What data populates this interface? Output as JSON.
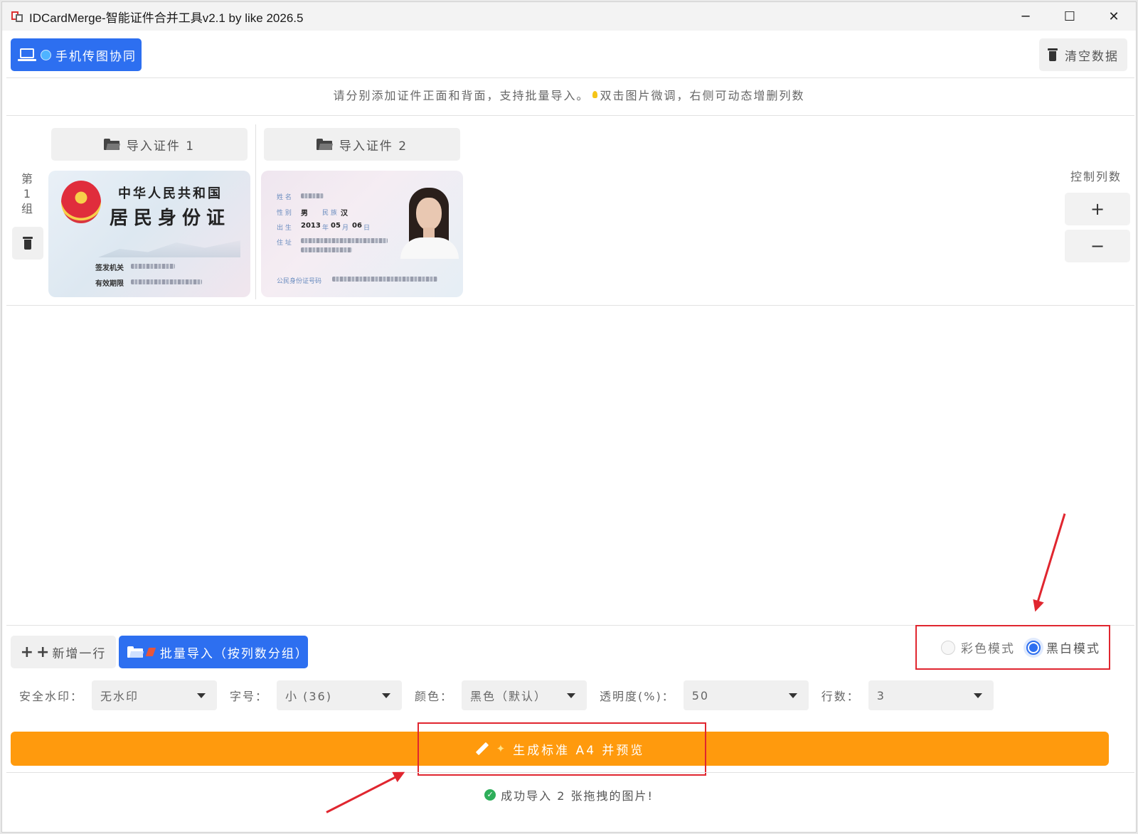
{
  "window": {
    "title": "IDCardMerge-智能证件合并工具v2.1 by like 2026.5",
    "minimize": "─",
    "maximize": "☐",
    "close": "✕"
  },
  "toolbar": {
    "mobile_label": "手机传图协同",
    "clear_label": "清空数据"
  },
  "hint": {
    "part1": "请分别添加证件正面和背面，支持批量导入。",
    "part2": "双击图片微调，右侧可动态增删列数"
  },
  "group": {
    "label_chars": [
      "第",
      "1",
      "组"
    ],
    "import_buttons": [
      "导入证件 1",
      "导入证件 2"
    ]
  },
  "card_front": {
    "line1": "中华人民共和国",
    "line2": "居民身份证",
    "issuer_label": "签发机关",
    "validity_label": "有效期限"
  },
  "card_back": {
    "name_label": "姓 名",
    "gender_label": "性 别",
    "gender_value": "男",
    "ethnic_label": "民 族",
    "ethnic_value": "汉",
    "birth_label": "出 生",
    "birth_year": "2013",
    "year_unit": "年",
    "birth_month": "05",
    "month_unit": "月",
    "birth_day": "06",
    "day_unit": "日",
    "address_label": "住 址",
    "id_label": "公民身份证号码"
  },
  "columns_control": {
    "label": "控制列数",
    "add": "+",
    "remove": "−"
  },
  "bottom": {
    "add_row_label": "新增一行",
    "batch_import_label": "批量导入（按列数分组）",
    "mode_color": "彩色模式",
    "mode_bw": "黑白模式",
    "selected_mode": "黑白模式"
  },
  "settings": {
    "watermark_label": "安全水印：",
    "watermark_value": "无水印",
    "font_size_label": "字号：",
    "font_size_value": "小 (36)",
    "color_label": "颜色：",
    "color_value": "黑色（默认）",
    "opacity_label": "透明度(%)：",
    "opacity_value": "50",
    "rows_label": "行数：",
    "rows_value": "3"
  },
  "generate": {
    "label": "生成标准 A4 并预览"
  },
  "status": {
    "message": "成功导入 2 张拖拽的图片!"
  },
  "colors": {
    "primary_blue": "#2d6ff0",
    "generate_orange": "#ff9a0d",
    "annotation_red": "#e0262f",
    "success_green": "#2eae5a"
  }
}
